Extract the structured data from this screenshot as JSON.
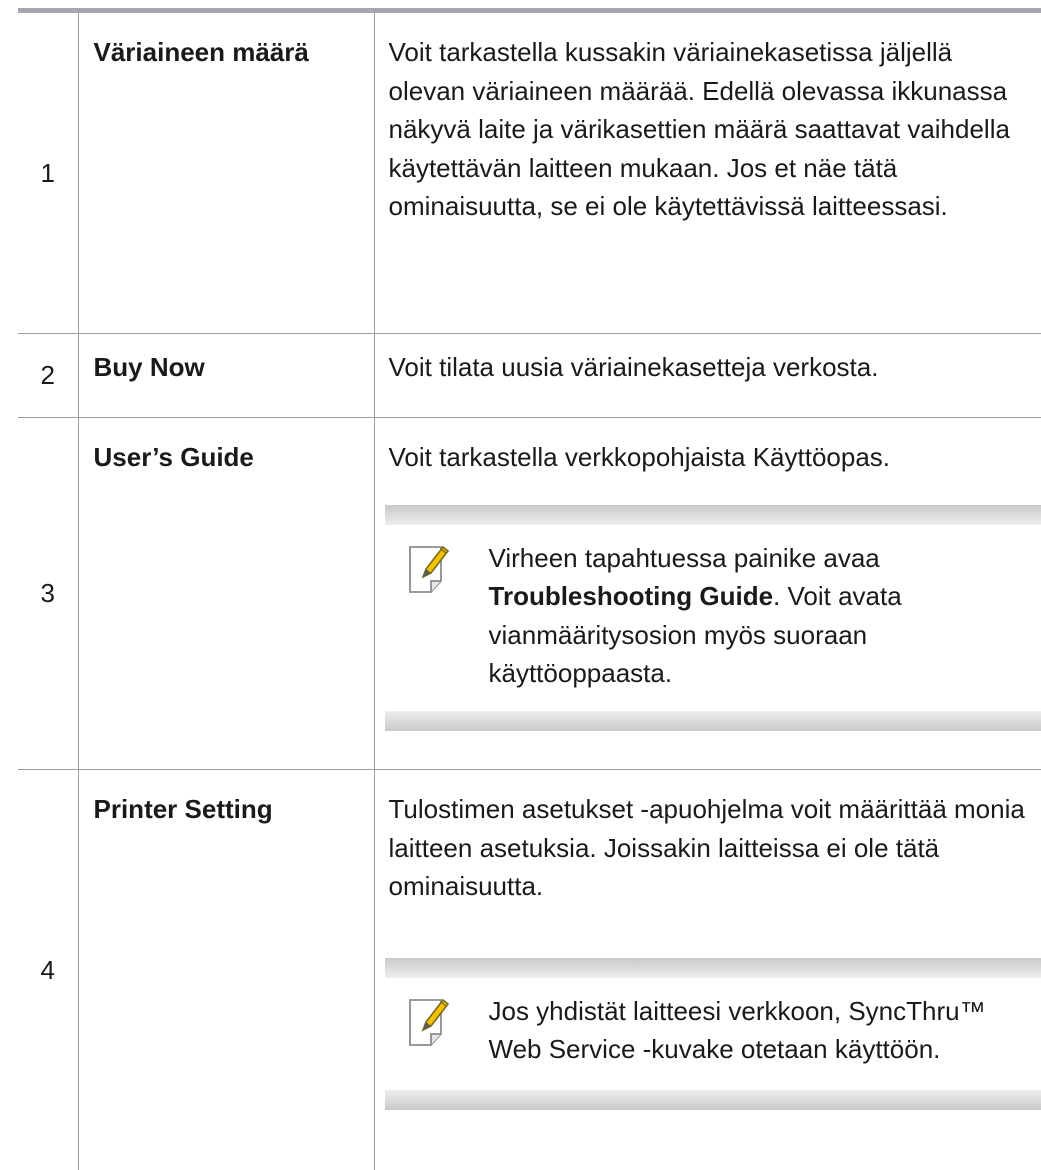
{
  "table": {
    "rows": [
      {
        "number": "1",
        "label": "Väriaineen määrä",
        "description": "Voit tarkastella kussakin väriainekasetissa jäljellä olevan väriaineen määrää. Edellä olevassa ikkunassa näkyvä laite ja värikasettien määrä saattavat vaihdella käytettävän laitteen mukaan. Jos et näe tätä ominaisuutta, se ei ole käytettävissä laitteessasi."
      },
      {
        "number": "2",
        "label": "Buy Now",
        "description": "Voit tilata uusia väriainekasetteja verkosta."
      },
      {
        "number": "3",
        "label": "User’s Guide",
        "description": "Voit tarkastella verkkopohjaista Käyttöopas.",
        "note": {
          "icon": "note-pencil-icon",
          "before": "Virheen tapahtuessa painike avaa ",
          "bold": "Troubleshooting Guide",
          "after": ". Voit avata vianmääritysosion myös suoraan käyttöoppaasta."
        }
      },
      {
        "number": "4",
        "label": "Printer Setting",
        "description": "Tulostimen asetukset -apuohjelma voit määrittää monia laitteen asetuksia. Joissakin laitteissa ei ole tätä ominaisuutta.",
        "note": {
          "icon": "note-pencil-icon",
          "text": "Jos yhdistät laitteesi verkkoon, SyncThru™ Web Service -kuvake otetaan käyttöön."
        }
      }
    ]
  },
  "colors": {
    "border": "#9d9d9d",
    "top_rule": "#a5a5ad",
    "note_band_dark": "#c9c9c9",
    "note_band_light": "#eeeeee",
    "icon_pencil": "#f2c200"
  }
}
